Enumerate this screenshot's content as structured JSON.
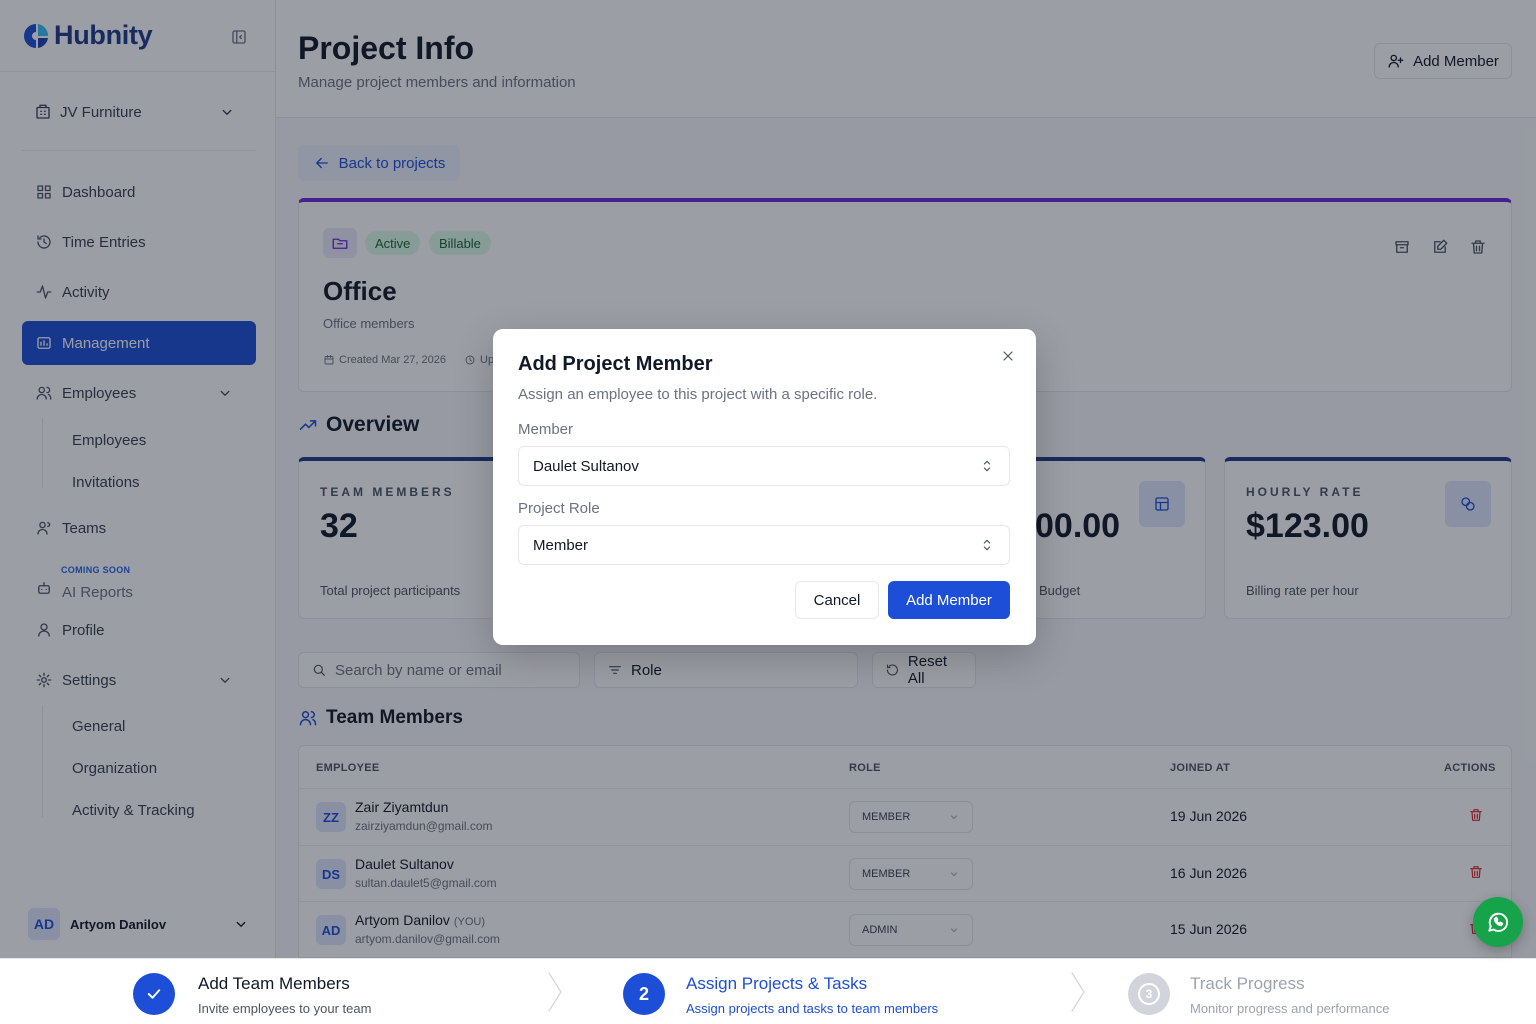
{
  "brand": {
    "name": "Hubnity"
  },
  "sidebar": {
    "org": "JV Furniture",
    "items": {
      "dashboard": "Dashboard",
      "time_entries": "Time Entries",
      "activity": "Activity",
      "management": "Management",
      "employees": "Employees",
      "employees_sub": "Employees",
      "invitations": "Invitations",
      "teams": "Teams",
      "coming_soon": "COMING SOON",
      "ai_reports": "AI Reports",
      "profile": "Profile",
      "settings": "Settings",
      "general": "General",
      "organization": "Organization",
      "activity_tracking": "Activity & Tracking"
    },
    "user": {
      "initials": "AD",
      "name": "Artyom Danilov"
    }
  },
  "header": {
    "title": "Project Info",
    "subtitle": "Manage project members and information",
    "add_member": "Add Member"
  },
  "back": "Back to projects",
  "project": {
    "badges": [
      "Active",
      "Billable"
    ],
    "name": "Office",
    "description": "Office members",
    "created": "Created Mar 27, 2026",
    "updated_partial": "Up"
  },
  "overview": {
    "title": "Overview",
    "team_members": {
      "label": "TEAM MEMBERS",
      "value": "32",
      "desc": "Total project participants"
    },
    "budget": {
      "value_partial": "00.00",
      "desc_partial": "Budget"
    },
    "hourly_rate": {
      "label": "HOURLY RATE",
      "value": "$123.00",
      "desc": "Billing rate per hour"
    }
  },
  "filters": {
    "search_placeholder": "Search by name or email",
    "role": "Role",
    "reset": "Reset All"
  },
  "members": {
    "title": "Team Members",
    "columns": {
      "employee": "EMPLOYEE",
      "role": "ROLE",
      "joined": "JOINED AT",
      "actions": "ACTIONS"
    },
    "rows": [
      {
        "initials": "ZZ",
        "name": "Zair Ziyamtdun",
        "you": "",
        "email": "zairziyamdun@gmail.com",
        "role": "MEMBER",
        "joined": "19 Jun 2026"
      },
      {
        "initials": "DS",
        "name": "Daulet Sultanov",
        "you": "",
        "email": "sultan.daulet5@gmail.com",
        "role": "MEMBER",
        "joined": "16 Jun 2026"
      },
      {
        "initials": "AD",
        "name": "Artyom Danilov",
        "you": "(YOU)",
        "email": "artyom.danilov@gmail.com",
        "role": "ADMIN",
        "joined": "15 Jun 2026"
      }
    ]
  },
  "modal": {
    "title": "Add Project Member",
    "subtitle": "Assign an employee to this project with a specific role.",
    "member_label": "Member",
    "member_value": "Daulet Sultanov",
    "role_label": "Project Role",
    "role_value": "Member",
    "cancel": "Cancel",
    "submit": "Add Member"
  },
  "steps": [
    {
      "number": "",
      "title": "Add Team Members",
      "subtitle": "Invite employees to your team",
      "state": "done"
    },
    {
      "number": "2",
      "title": "Assign Projects & Tasks",
      "subtitle": "Assign projects and tasks to team members",
      "state": "current"
    },
    {
      "number": "3",
      "title": "Track Progress",
      "subtitle": "Monitor progress and performance",
      "state": "pending"
    }
  ],
  "colors": {
    "primary": "#1d4ed8",
    "brand": "#1e3a8a",
    "accent_purple": "#6d28d9",
    "success": "#16a34a",
    "danger": "#dc2626"
  }
}
